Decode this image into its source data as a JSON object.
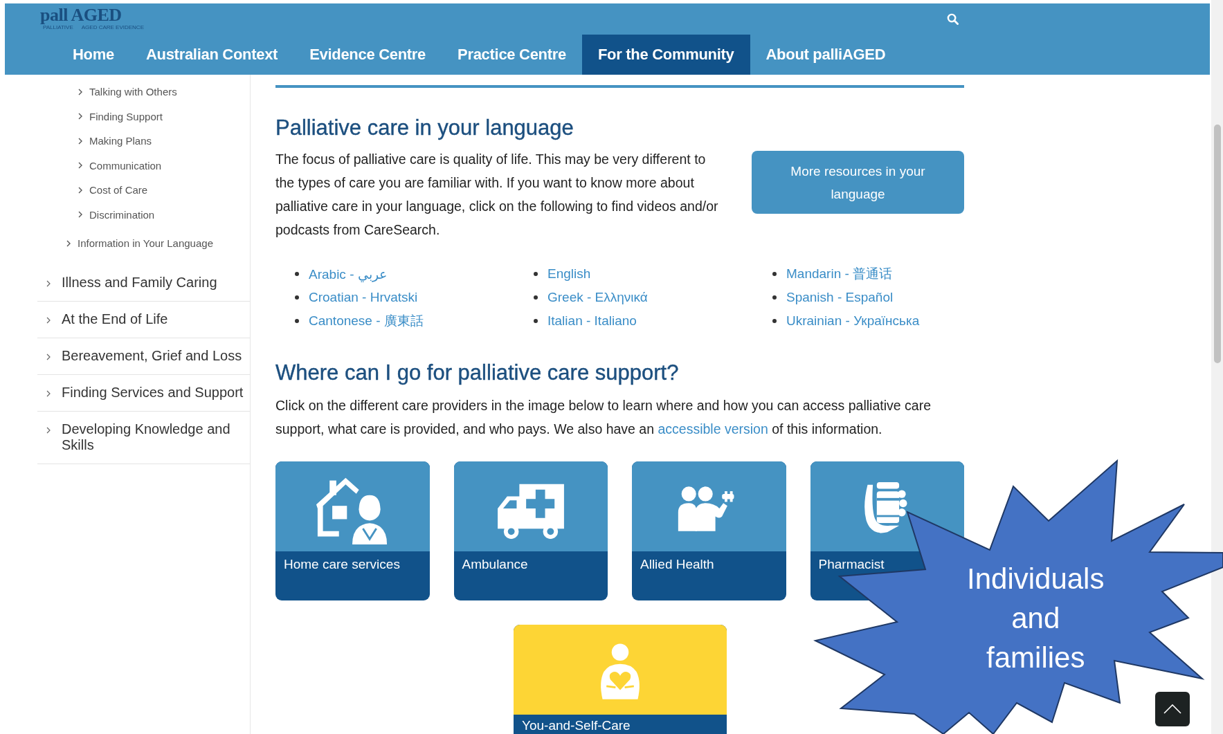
{
  "header": {
    "logo": {
      "wordmark": "pall AGED",
      "tagline_left": "PALLIATIVE",
      "tagline_right": "AGED CARE EVIDENCE"
    },
    "nav": [
      {
        "label": "Home",
        "selected": false
      },
      {
        "label": "Australian Context",
        "selected": false
      },
      {
        "label": "Evidence Centre",
        "selected": false
      },
      {
        "label": "Practice Centre",
        "selected": false
      },
      {
        "label": "For the Community",
        "selected": true
      },
      {
        "label": "About palliAGED",
        "selected": false
      }
    ]
  },
  "sidebar": {
    "subtopics": [
      "Talking with Others",
      "Finding Support",
      "Making Plans",
      "Communication",
      "Cost of Care",
      "Discrimination"
    ],
    "section_links": [
      "Information in Your Language"
    ],
    "topics": [
      "Illness and Family Caring",
      "At the End of Life",
      "Bereavement, Grief and Loss",
      "Finding Services and Support",
      "Developing Knowledge and Skills"
    ]
  },
  "language_section": {
    "heading": "Palliative care in your language",
    "intro": "The focus of palliative care is quality of life. This may be very different to the types of care you are familiar with. If you want to know more about palliative care in your language, click on the following to find videos and/or podcasts from CareSearch.",
    "button": "More resources in your language",
    "languages": [
      "Arabic - عربي",
      "Croatian - Hrvatski",
      "Cantonese - 廣東話",
      "English",
      "Greek - Ελληνικά",
      "Italian - Italiano",
      "Mandarin - 普通话",
      "Spanish - Español",
      "Ukrainian - Українська"
    ]
  },
  "support_section": {
    "heading": "Where can I go for palliative care support?",
    "text_before": "Click on the different care providers in the image below to learn where and how you can access palliative care support, what care is provided, and who pays. We also have an ",
    "link": "accessible version",
    "text_after": " of this information.",
    "tiles": [
      {
        "label": "Home care services",
        "kind": "home"
      },
      {
        "label": "Ambulance",
        "kind": "ambulance"
      },
      {
        "label": "Allied Health",
        "kind": "allied"
      },
      {
        "label": "Pharmacist",
        "kind": "pharmacist"
      }
    ],
    "feature_tile": {
      "label": "You-and-Self-Care",
      "kind": "self"
    }
  },
  "callout": {
    "text": "Individuals and families"
  }
}
